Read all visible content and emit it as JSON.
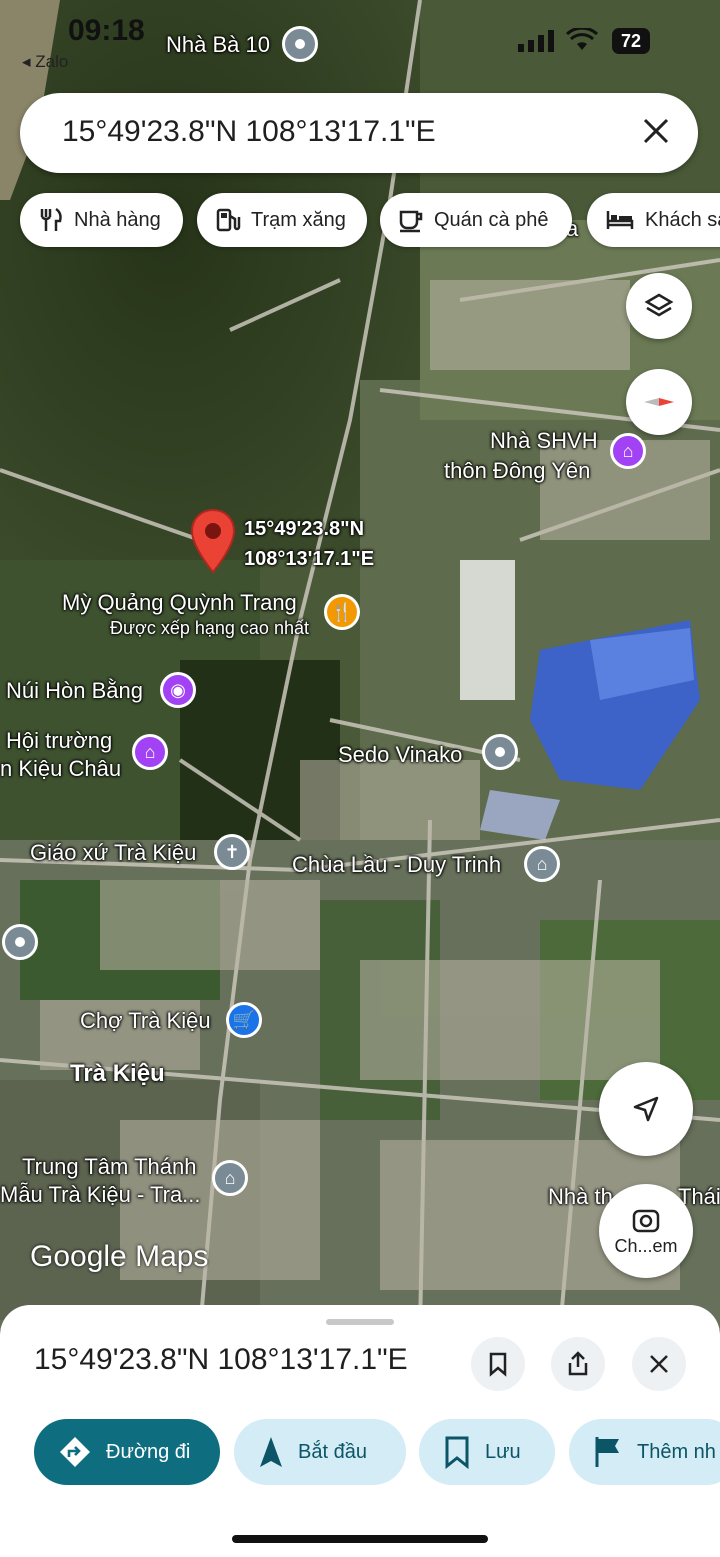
{
  "status_bar": {
    "time": "09:18",
    "back_app": "◂ Zalo",
    "battery": "72"
  },
  "search": {
    "query": "15°49'23.8\"N 108°13'17.1\"E"
  },
  "chips": [
    {
      "label": "Nhà hàng",
      "icon": "fork-knife-icon"
    },
    {
      "label": "Trạm xăng",
      "icon": "gas-station-icon"
    },
    {
      "label": "Quán cà phê",
      "icon": "coffee-icon"
    },
    {
      "label": "Khách sạn",
      "icon": "bed-icon"
    }
  ],
  "map": {
    "pin_coords_line1": "15°49'23.8\"N",
    "pin_coords_line2": "108°13'17.1\"E",
    "places": {
      "nha_ba_10": "Nhà Bà 10",
      "shvh_line1": "Nhà SHVH",
      "shvh_line2": "thôn Đông Yên",
      "my_quang": "Mỳ Quảng Quỳnh Trang",
      "my_quang_sub": "Được xếp hạng cao nhất",
      "nui_hon_bang": "Núi Hòn Bằng",
      "hoi_truong_line1": "Hội trường",
      "hoi_truong_line2": "n Kiệu Châu",
      "sedo_vinako": "Sedo Vinako",
      "giao_xu": "Giáo xứ Trà Kiệu",
      "chua_lau": "Chùa Lầu - Duy Trinh",
      "cho_tra_kieu": "Chợ Trà Kiệu",
      "tra_kieu": "Trà Kiệu",
      "trung_tam_line1": "Trung Tâm Thánh",
      "trung_tam_line2": "Mẫu Trà Kiệu - Tra...",
      "nha_th": "Nhà th",
      "thai": "Thái",
      "partial_a": "a"
    },
    "logo": "Google Maps",
    "lens_label": "Ch...em"
  },
  "sheet": {
    "title": "15°49'23.8\"N 108°13'17.1\"E",
    "actions": [
      {
        "label": "Đường đi",
        "icon": "directions-icon"
      },
      {
        "label": "Bắt đầu",
        "icon": "navigation-arrow-icon"
      },
      {
        "label": "Lưu",
        "icon": "bookmark-icon"
      },
      {
        "label": "Thêm nh",
        "icon": "flag-icon"
      }
    ]
  },
  "colors": {
    "primary": "#0e6e80",
    "pin": "#ea4335",
    "poi_purple": "#a142f4",
    "poi_orange": "#f29900",
    "poi_blue": "#1a73e8",
    "poi_gray": "#7a8b95"
  }
}
